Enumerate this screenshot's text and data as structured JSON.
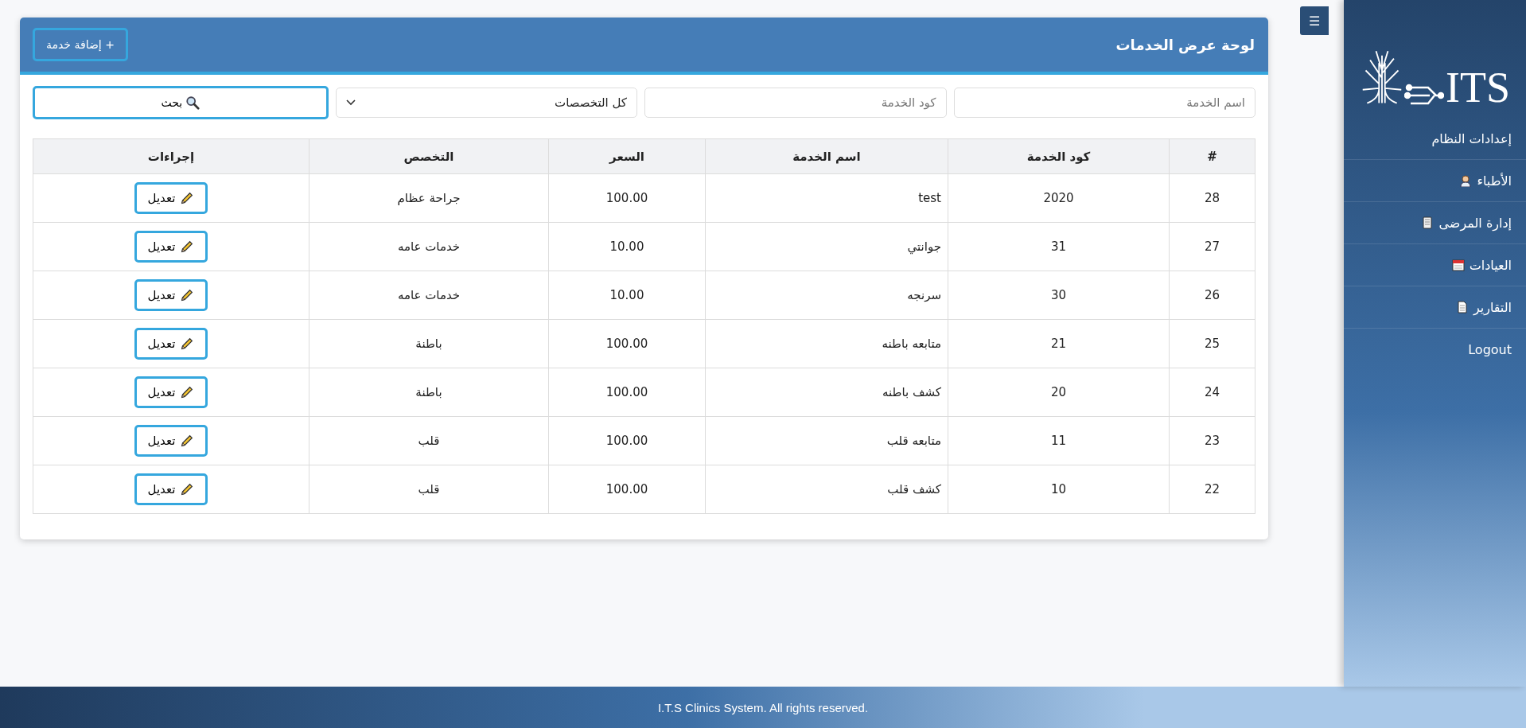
{
  "sidebar": {
    "logo": "ITS",
    "items": [
      {
        "label": "إعدادات النظام"
      },
      {
        "label": "الأطباء"
      },
      {
        "label": "إدارة المرضى"
      },
      {
        "label": "العيادات"
      },
      {
        "label": "التقارير"
      },
      {
        "label": "Logout"
      }
    ]
  },
  "menu_toggle": "☰",
  "panel": {
    "title": "لوحة عرض الخدمات",
    "add_button": "+ إضافة خدمة"
  },
  "filters": {
    "name": {
      "placeholder": "اسم الخدمة"
    },
    "code": {
      "placeholder": "كود الخدمة"
    },
    "specialty": {
      "value": "كل التخصصات"
    },
    "search_button": "بحث"
  },
  "table": {
    "columns": [
      "#",
      "كود الخدمة",
      "اسم الخدمة",
      "السعر",
      "التخصص",
      "إجراءات"
    ],
    "rows": [
      {
        "id": "28",
        "code": "2020",
        "name": "test",
        "price": "100.00",
        "specialty": "جراحة عظام",
        "action": "تعديل"
      },
      {
        "id": "27",
        "code": "31",
        "name": "جوانتي",
        "price": "10.00",
        "specialty": "خدمات عامه",
        "action": "تعديل"
      },
      {
        "id": "26",
        "code": "30",
        "name": "سرنجه",
        "price": "10.00",
        "specialty": "خدمات عامه",
        "action": "تعديل"
      },
      {
        "id": "25",
        "code": "21",
        "name": "متابعه باطنه",
        "price": "100.00",
        "specialty": "باطنة",
        "action": "تعديل"
      },
      {
        "id": "24",
        "code": "20",
        "name": "كشف باطنه",
        "price": "100.00",
        "specialty": "باطنة",
        "action": "تعديل"
      },
      {
        "id": "23",
        "code": "11",
        "name": "متابعه قلب",
        "price": "100.00",
        "specialty": "قلب",
        "action": "تعديل"
      },
      {
        "id": "22",
        "code": "10",
        "name": "كشف قلب",
        "price": "100.00",
        "specialty": "قلب",
        "action": "تعديل"
      }
    ]
  },
  "footer": "I.T.S Clinics System. All rights reserved."
}
